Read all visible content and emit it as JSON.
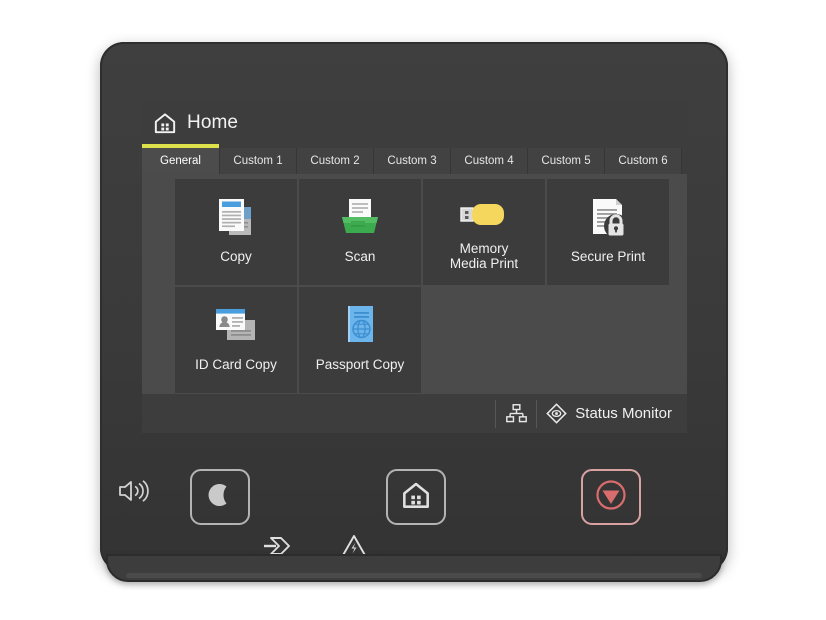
{
  "device": {
    "name": "multifunction-printer-control-panel"
  },
  "screen": {
    "titlebar": {
      "icon": "home-icon",
      "title": "Home"
    },
    "tabs": [
      {
        "label": "General",
        "active": true
      },
      {
        "label": "Custom 1",
        "active": false
      },
      {
        "label": "Custom 2",
        "active": false
      },
      {
        "label": "Custom 3",
        "active": false
      },
      {
        "label": "Custom 4",
        "active": false
      },
      {
        "label": "Custom 5",
        "active": false
      },
      {
        "label": "Custom 6",
        "active": false
      }
    ],
    "tiles": [
      {
        "label": "Copy",
        "icon": "copy-icon"
      },
      {
        "label": "Scan",
        "icon": "scan-icon"
      },
      {
        "label": "Memory\nMedia Print",
        "icon": "usb-drive-icon"
      },
      {
        "label": "Secure Print",
        "icon": "document-lock-icon"
      },
      {
        "label": "ID Card Copy",
        "icon": "id-card-icon"
      },
      {
        "label": "Passport Copy",
        "icon": "passport-icon"
      }
    ],
    "statusbar": {
      "network_icon": "network-icon",
      "status_monitor_icon": "status-monitor-diamond-icon",
      "status_monitor_label": "Status Monitor"
    }
  },
  "hardware": {
    "speaker_icon": "speaker-volume-icon",
    "buttons": [
      {
        "name": "energy-saver-button",
        "icon": "moon-icon"
      },
      {
        "name": "home-button",
        "icon": "home-icon"
      },
      {
        "name": "stop-button",
        "icon": "stop-icon"
      }
    ],
    "indicators": [
      {
        "name": "data-indicator",
        "icon": "data-arrow-icon"
      },
      {
        "name": "error-indicator",
        "icon": "warning-triangle-icon"
      }
    ]
  },
  "colors": {
    "accent_yellow": "#dde14a",
    "copy_blue": "#4a9ede",
    "scan_green": "#3caa4e",
    "usb_yellow": "#f5d75e",
    "passport_blue": "#6cb4ec",
    "stop_red": "#d96c6c",
    "screen_bg": "#373737",
    "tile_bg": "#3c3c3c",
    "content_bg": "#4b4b4b"
  }
}
